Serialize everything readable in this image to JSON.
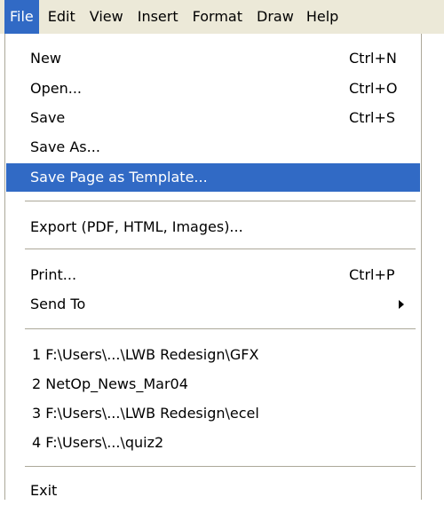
{
  "menubar": {
    "items": [
      {
        "label": "File"
      },
      {
        "label": "Edit"
      },
      {
        "label": "View"
      },
      {
        "label": "Insert"
      },
      {
        "label": "Format"
      },
      {
        "label": "Draw"
      },
      {
        "label": "Help"
      }
    ],
    "active": "File"
  },
  "file_menu": {
    "new": {
      "label": "New",
      "shortcut": "Ctrl+N"
    },
    "open": {
      "label": "Open...",
      "shortcut": "Ctrl+O"
    },
    "save": {
      "label": "Save",
      "shortcut": "Ctrl+S"
    },
    "save_as": {
      "label": "Save As..."
    },
    "save_template": {
      "label": "Save Page as Template..."
    },
    "export": {
      "label": "Export (PDF, HTML, Images)..."
    },
    "print": {
      "label": "Print...",
      "shortcut": "Ctrl+P"
    },
    "send_to": {
      "label": "Send To"
    },
    "recent": [
      {
        "label": "1 F:\\Users\\...\\LWB Redesign\\GFX"
      },
      {
        "label": "2 NetOp_News_Mar04"
      },
      {
        "label": "3 F:\\Users\\...\\LWB Redesign\\ecel"
      },
      {
        "label": "4 F:\\Users\\...\\quiz2"
      }
    ],
    "exit": {
      "label": "Exit"
    }
  },
  "colors": {
    "highlight": "#316ac5",
    "menubar_bg": "#ece9d8",
    "separator": "#aca899"
  }
}
